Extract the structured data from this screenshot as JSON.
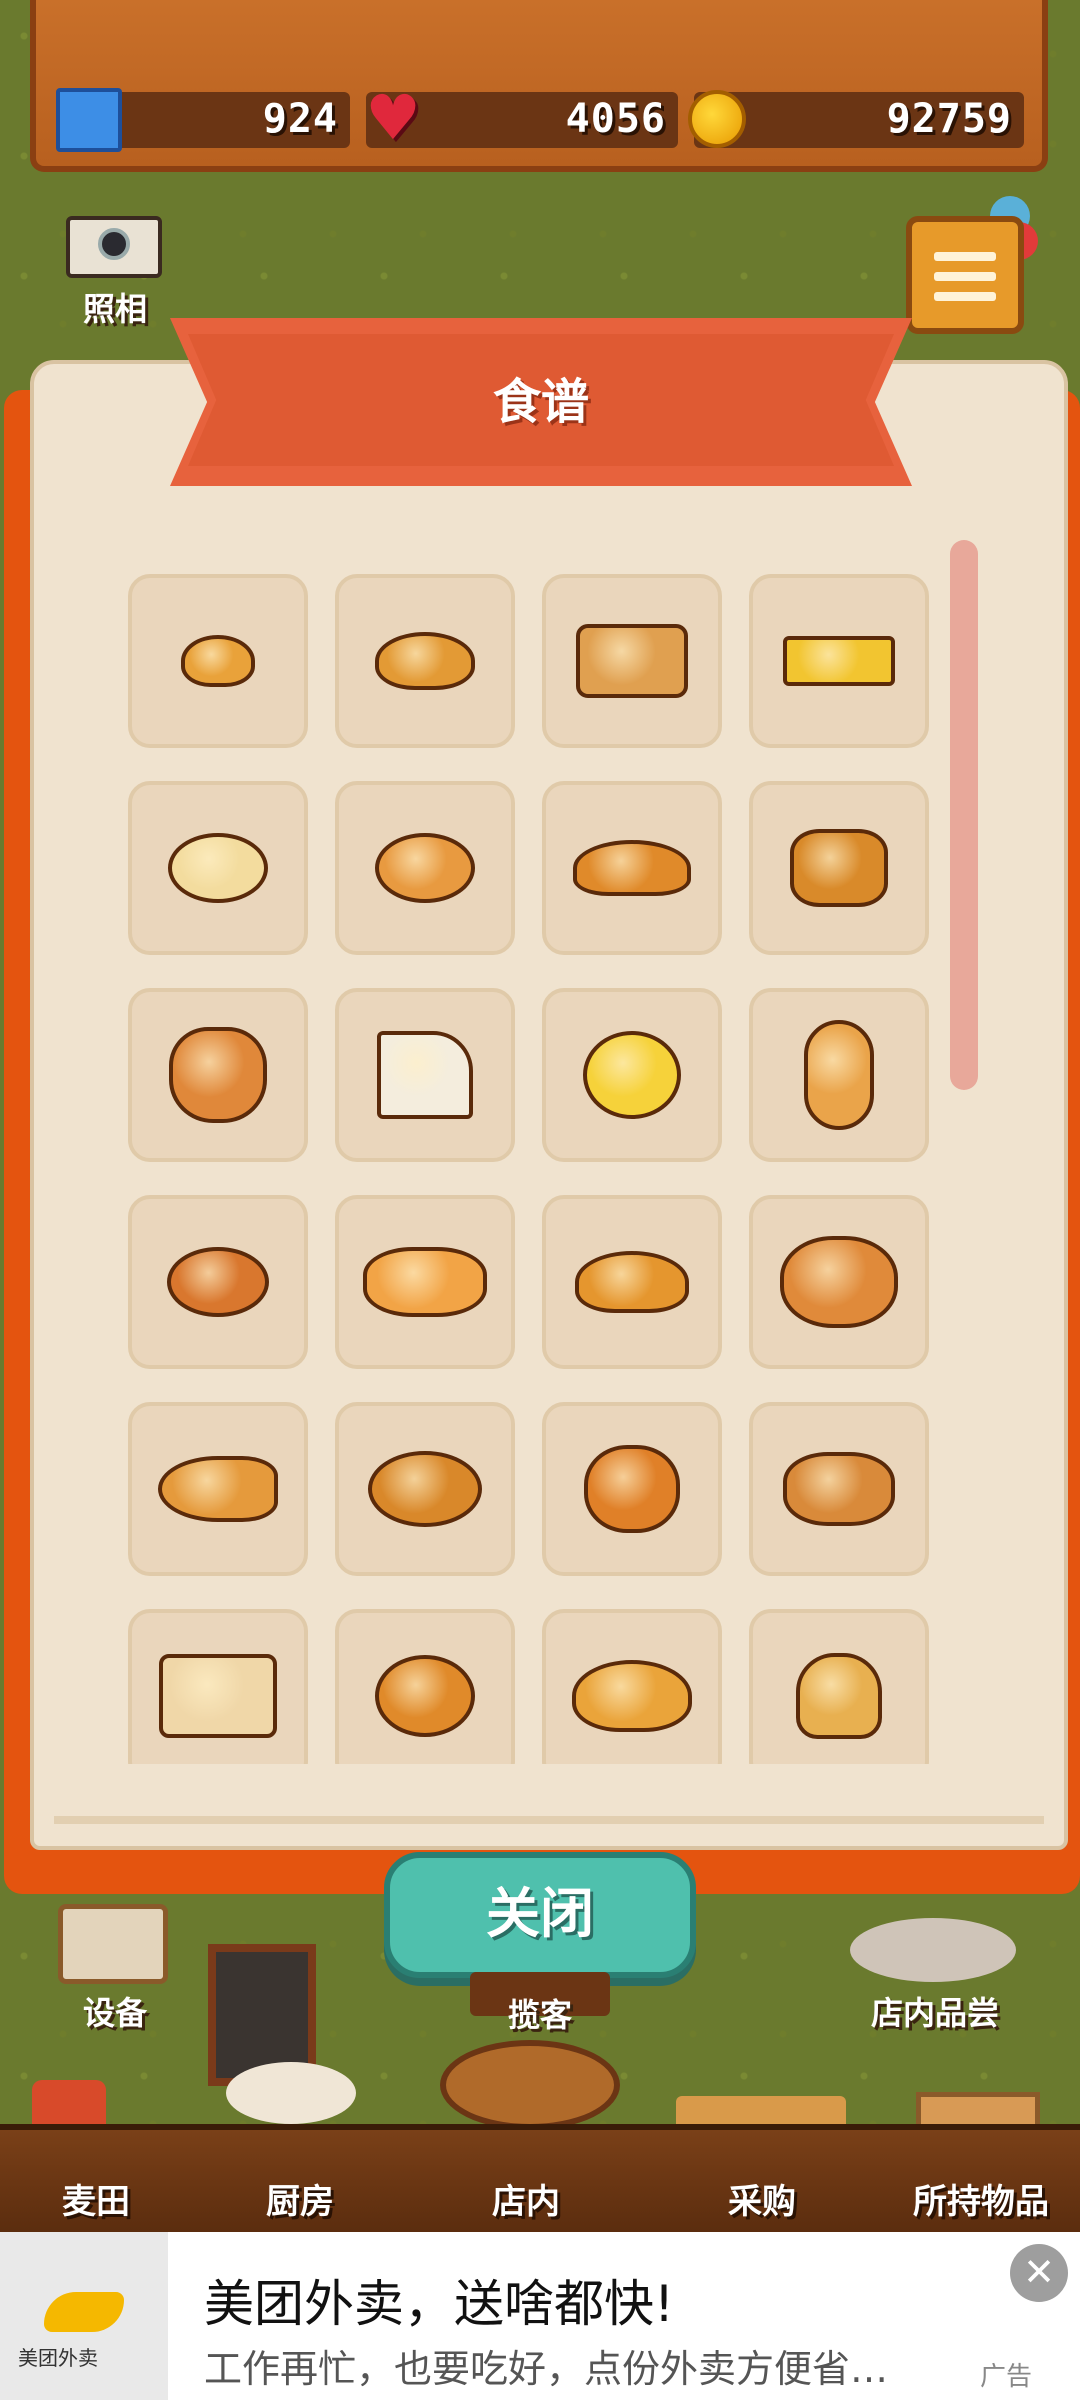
{
  "currency": {
    "tickets": "924",
    "hearts": "4056",
    "coins": "92759"
  },
  "camera_label": "照相",
  "recipe_book": {
    "title": "食谱",
    "items": [
      "small-bun",
      "round-bread",
      "loaf-bread",
      "castella",
      "plain-donut",
      "ring-donut",
      "croissant",
      "melon-pastry",
      "bunny-bread",
      "sandwich",
      "melon-pan",
      "baguette",
      "sprinkle-donut",
      "pizza-bread",
      "cream-bread",
      "jam-danish",
      "chocolate-cornet",
      "sugar-bread",
      "bear-bread",
      "cinnamon-roll",
      "egg-toast",
      "round-pie",
      "cream-croissant",
      "burger"
    ]
  },
  "close_button": "关闭",
  "floor_labels": {
    "equipment": "设备",
    "solicit": "揽客",
    "tasting": "店内品尝"
  },
  "nav": [
    "麦田",
    "厨房",
    "店内",
    "采购",
    "所持物品"
  ],
  "ad": {
    "brand": "美团外卖",
    "title": "美团外卖，送啥都快!",
    "subtitle": "工作再忙，也要吃好，点份外卖方便省…",
    "tag": "广告",
    "close": "✕"
  },
  "colors": {
    "book_red": "#e4540f",
    "button_teal": "#4fc0ad",
    "wood": "#c9702a"
  }
}
